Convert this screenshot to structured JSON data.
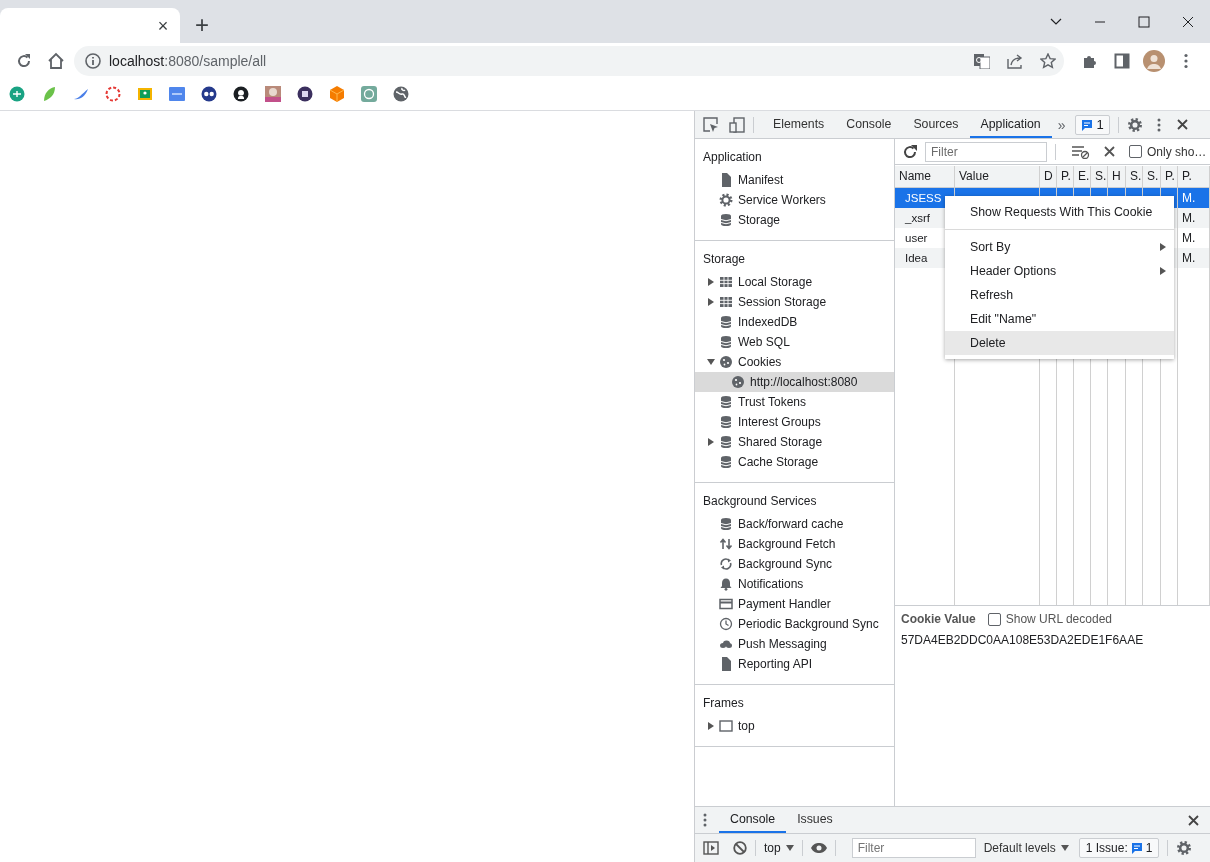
{
  "browser": {
    "tab_close": "×",
    "new_tab": "+",
    "url_host": "localhost",
    "url_path": ":8080/sample/all"
  },
  "devtools": {
    "tabs": [
      {
        "label": "Elements",
        "selected": false
      },
      {
        "label": "Console",
        "selected": false
      },
      {
        "label": "Sources",
        "selected": false
      },
      {
        "label": "Application",
        "selected": true
      }
    ],
    "more_tabs": "»",
    "issues_count": "1",
    "sidebar": [
      {
        "title": "Application",
        "items": [
          {
            "label": "Manifest",
            "kind": "file",
            "selected": false
          },
          {
            "label": "Service Workers",
            "kind": "gear",
            "selected": false
          },
          {
            "label": "Storage",
            "kind": "db",
            "selected": false
          }
        ]
      },
      {
        "title": "Storage",
        "items": [
          {
            "label": "Local Storage",
            "kind": "grid",
            "selected": false,
            "expanded": false
          },
          {
            "label": "Session Storage",
            "kind": "grid",
            "selected": false,
            "expanded": false
          },
          {
            "label": "IndexedDB",
            "kind": "db",
            "selected": false
          },
          {
            "label": "Web SQL",
            "kind": "db",
            "selected": false
          },
          {
            "label": "Cookies",
            "kind": "cookie",
            "selected": false,
            "expanded": true,
            "children": [
              {
                "label": "http://localhost:8080",
                "kind": "cookie",
                "selected": true
              }
            ]
          },
          {
            "label": "Trust Tokens",
            "kind": "db",
            "selected": false
          },
          {
            "label": "Interest Groups",
            "kind": "db",
            "selected": false
          },
          {
            "label": "Shared Storage",
            "kind": "db",
            "selected": false,
            "expanded": false
          },
          {
            "label": "Cache Storage",
            "kind": "db",
            "selected": false
          }
        ]
      },
      {
        "title": "Background Services",
        "items": [
          {
            "label": "Back/forward cache",
            "kind": "db",
            "selected": false
          },
          {
            "label": "Background Fetch",
            "kind": "arrows",
            "selected": false
          },
          {
            "label": "Background Sync",
            "kind": "sync",
            "selected": false
          },
          {
            "label": "Notifications",
            "kind": "bell",
            "selected": false
          },
          {
            "label": "Payment Handler",
            "kind": "card",
            "selected": false
          },
          {
            "label": "Periodic Background Sync",
            "kind": "clock",
            "selected": false
          },
          {
            "label": "Push Messaging",
            "kind": "cloud",
            "selected": false
          },
          {
            "label": "Reporting API",
            "kind": "file",
            "selected": false
          }
        ]
      },
      {
        "title": "Frames",
        "items": [
          {
            "label": "top",
            "kind": "frame",
            "selected": false,
            "expanded": false
          }
        ]
      }
    ],
    "cookies": {
      "filter": {
        "placeholder": "Filter"
      },
      "only_show": {
        "label": "Only sho…",
        "checked": false
      },
      "columns": [
        "Name",
        "Value",
        "D",
        "P.",
        "E.",
        "S.",
        "H",
        "S.",
        "S.",
        "P.",
        "P."
      ],
      "rows": [
        {
          "name": "JSESS",
          "column_11": "M.",
          "selected": true
        },
        {
          "name": "_xsrf",
          "column_11": "M.",
          "selected": false
        },
        {
          "name": "user",
          "column_11": "M.",
          "selected": false
        },
        {
          "name": "Idea",
          "column_11": "M.",
          "selected": false
        }
      ],
      "cookie_value": {
        "title": "Cookie Value",
        "decode": {
          "label": "Show URL decoded",
          "checked": false
        },
        "value": "57DA4EB2DDC0AA108E53DA2EDE1F6AAE"
      }
    },
    "context_menu": [
      {
        "kind": "item",
        "label": "Show Requests With This Cookie",
        "submenu": false,
        "highlighted": false
      },
      {
        "kind": "separator"
      },
      {
        "kind": "item",
        "label": "Sort By",
        "submenu": true,
        "highlighted": false
      },
      {
        "kind": "item",
        "label": "Header Options",
        "submenu": true,
        "highlighted": false
      },
      {
        "kind": "item",
        "label": "Refresh",
        "submenu": false,
        "highlighted": false
      },
      {
        "kind": "item",
        "label": "Edit \"Name\"",
        "submenu": false,
        "highlighted": false
      },
      {
        "kind": "item",
        "label": "Delete",
        "submenu": false,
        "highlighted": true
      }
    ],
    "drawer": {
      "tabs": [
        {
          "label": "Console",
          "selected": true
        },
        {
          "label": "Issues",
          "selected": false
        }
      ],
      "context": "top",
      "filter": {
        "placeholder": "Filter"
      },
      "levels": "Default levels",
      "issues_label": "1 Issue:",
      "issues_count": "1"
    }
  }
}
